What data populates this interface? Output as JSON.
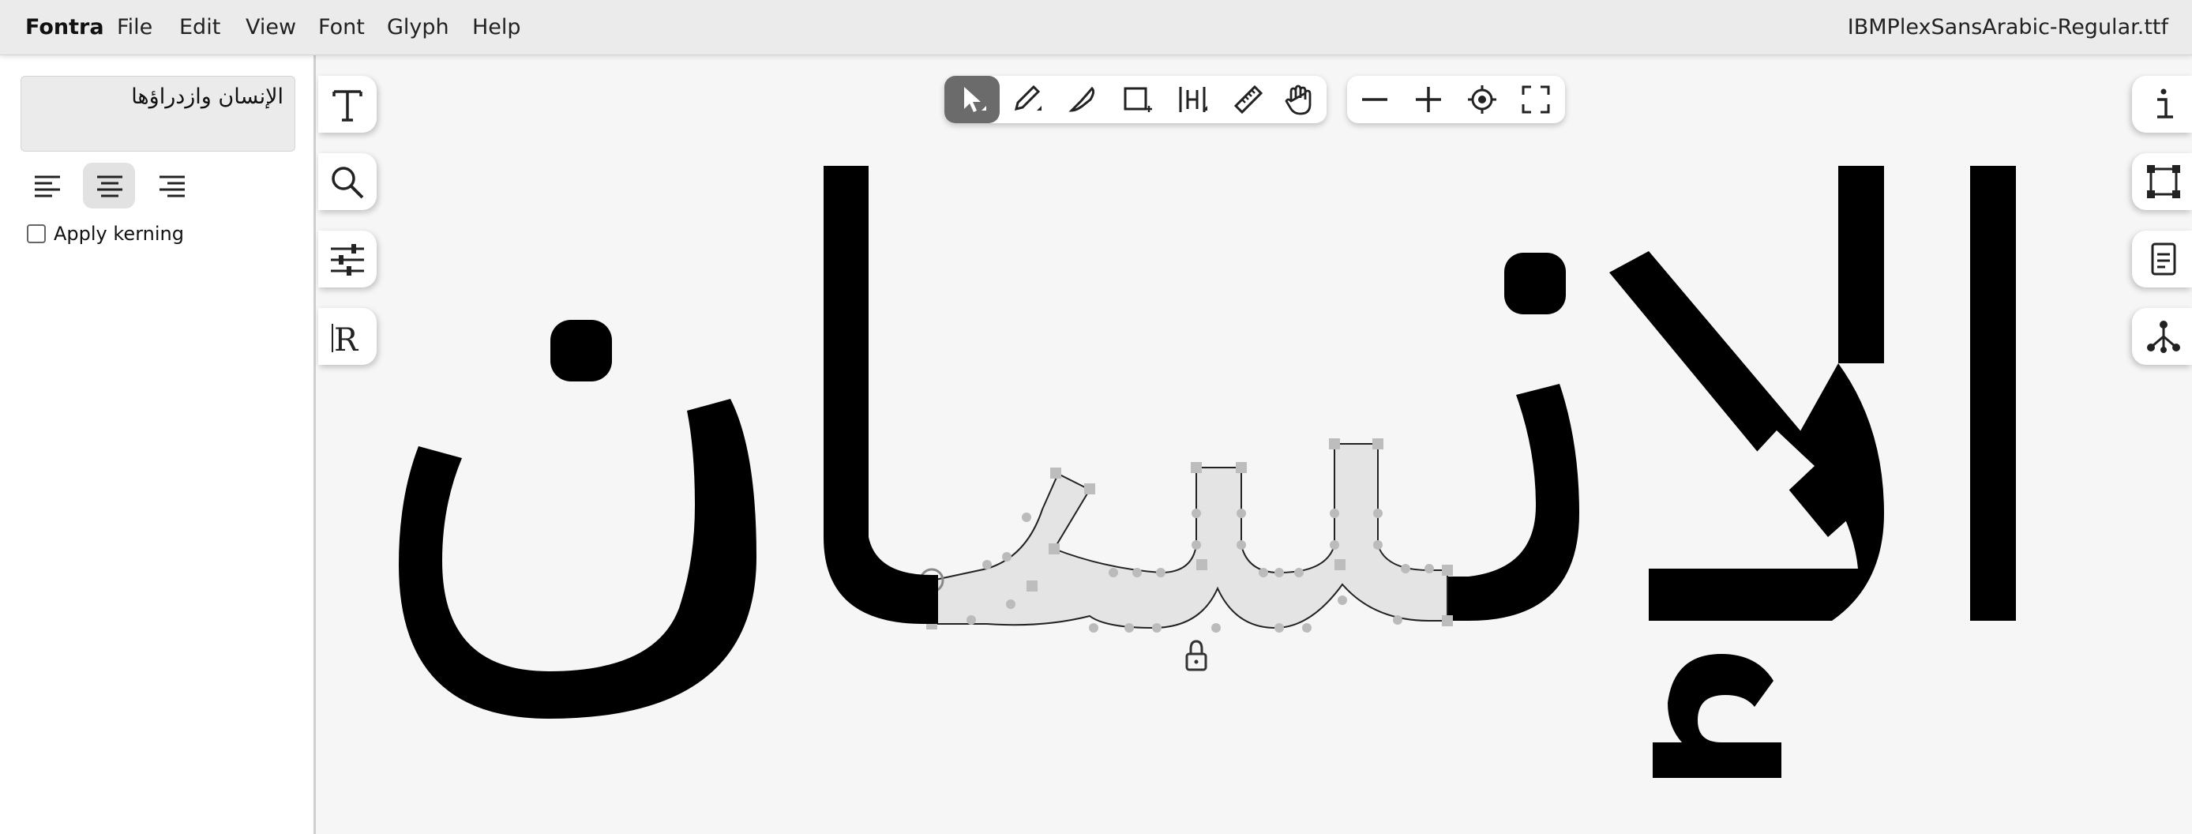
{
  "app": {
    "brand": "Fontra",
    "menus": [
      "File",
      "Edit",
      "View",
      "Font",
      "Glyph",
      "Help"
    ],
    "font_file": "IBMPlexSansArabic-Regular.ttf"
  },
  "sidebar": {
    "text_entry": "الإنسان وازدراؤها",
    "align_options": [
      "align-left",
      "align-center",
      "align-right"
    ],
    "selected_align": "align-center",
    "kerning_label": "Apply kerning",
    "kerning_checked": false
  },
  "left_tools": [
    "text-tool",
    "search-tool",
    "settings-tool",
    "reference-font-tool"
  ],
  "top_tools": [
    "pointer-tool",
    "pen-tool",
    "knife-tool",
    "rectangle-tool",
    "hamburger-tool",
    "measure-tool",
    "hand-tool"
  ],
  "active_tool": "pointer-tool",
  "zoom_tools": [
    "zoom-out",
    "zoom-in",
    "zoom-fit-selection",
    "fullscreen"
  ],
  "right_tools": [
    "info-icon",
    "transform-icon",
    "glyph-note-icon",
    "related-glyphs-icon"
  ],
  "canvas": {
    "text": "الإنسان",
    "selected_glyph": "seen",
    "glyph_fill": "#000000",
    "selected_fill": "#e4e4e4",
    "lock_icon": "lock-icon"
  }
}
